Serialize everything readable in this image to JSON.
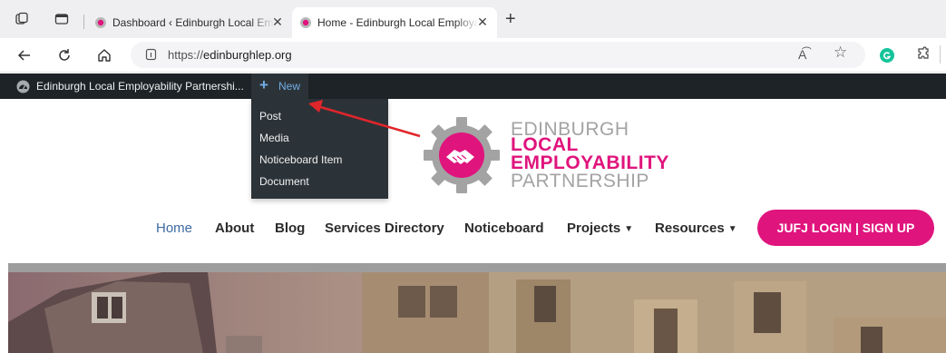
{
  "browser": {
    "tabs": [
      {
        "title": "Dashboard ‹ Edinburgh Local Emp",
        "active": false,
        "close": "✕"
      },
      {
        "title": "Home - Edinburgh Local Employa",
        "active": true,
        "close": "✕"
      }
    ],
    "new_tab": "+",
    "url_prefix": "https://",
    "url_domain": "edinburghlep.org",
    "reader_mode": "A͡",
    "favorite": "☆"
  },
  "admin_bar": {
    "site_name": "Edinburgh Local Employability Partnershi...",
    "new_label": "New",
    "new_plus": "+",
    "dropdown": [
      "Post",
      "Media",
      "Noticeboard Item",
      "Document"
    ]
  },
  "logo": {
    "line1": "EDINBURGH",
    "line2": "LOCAL",
    "line3": "EMPLOYABILITY",
    "line4": "PARTNERSHIP"
  },
  "menu": {
    "items": [
      "Home",
      "About",
      "Blog",
      "Services Directory",
      "Noticeboard",
      "Projects",
      "Resources"
    ],
    "caret": "▼",
    "login": "JUFJ LOGIN | SIGN UP"
  },
  "colors": {
    "brand_pink": "#e0147d",
    "logo_grey": "#a3a3a3",
    "admin_bar": "#1d2327",
    "admin_link": "#72aee6",
    "annotation_arrow": "#e0262b"
  }
}
